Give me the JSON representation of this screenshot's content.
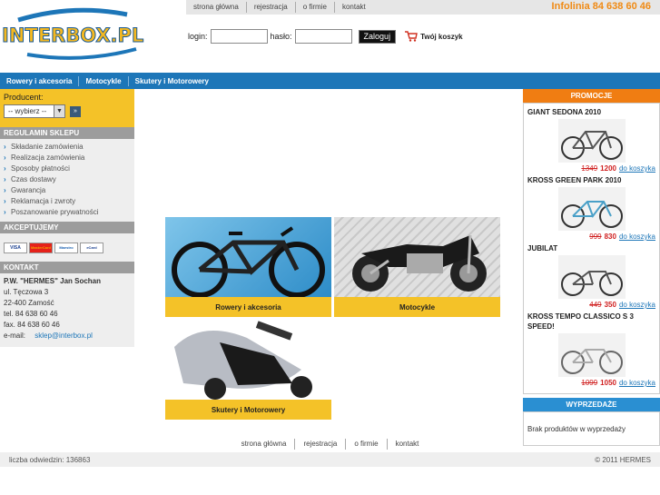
{
  "header": {
    "logo_text": "INTERBOX.PL",
    "top_nav": [
      "strona główna",
      "rejestracja",
      "o firmie",
      "kontakt"
    ],
    "infolinia": "Infolinia 84 638 60 46",
    "login_label": "login:",
    "password_label": "hasło:",
    "login_button": "Zaloguj",
    "cart_label": "Twój koszyk"
  },
  "nav": [
    "Rowery i akcesoria",
    "Motocykle",
    "Skutery i Motorowery"
  ],
  "left": {
    "producer_label": "Producent:",
    "producer_select": "-- wybierz --",
    "regulamin_title": "REGULAMIN SKLEPU",
    "regulamin_items": [
      "Składanie zamówienia",
      "Realizacja zamówienia",
      "Sposoby płatności",
      "Czas dostawy",
      "Gwarancja",
      "Reklamacja i zwroty",
      "Poszanowanie prywatności"
    ],
    "accept_title": "AKCEPTUJEMY",
    "cards": [
      "VISA",
      "MasterCard",
      "Maestro",
      "eCard"
    ],
    "contact_title": "KONTAKT",
    "contact": {
      "company": "P.W. \"HERMES\" Jan Sochan",
      "street": "ul. Tęczowa 3",
      "city": "22-400 Zamość",
      "tel": "tel. 84 638 60 46",
      "fax": "fax. 84 638 60 46",
      "email_label": "e-mail:",
      "email": "sklep@interbox.pl"
    }
  },
  "categories": [
    {
      "label": "Rowery i akcesoria"
    },
    {
      "label": "Motocykle"
    },
    {
      "label": "Skutery i Motorowery"
    }
  ],
  "right": {
    "promo_title": "PROMOCJE",
    "promos": [
      {
        "name": "GIANT SEDONA 2010",
        "old": "1349",
        "new": "1200",
        "link": "do koszyka"
      },
      {
        "name": "KROSS GREEN PARK 2010",
        "old": "999",
        "new": "830",
        "link": "do koszyka"
      },
      {
        "name": "JUBILAT",
        "old": "449",
        "new": "350",
        "link": "do koszyka"
      },
      {
        "name": "KROSS TEMPO CLASSICO S 3 SPEED!",
        "old": "1099",
        "new": "1050",
        "link": "do koszyka"
      }
    ],
    "sale_title": "WYPRZEDAŻE",
    "sale_text": "Brak produktów w wyprzedaży"
  },
  "footer": {
    "nav": [
      "strona główna",
      "rejestracja",
      "o firmie",
      "kontakt"
    ],
    "visits": "liczba odwiedzin: 136863",
    "copyright": "© 2011 HERMES"
  },
  "colors": {
    "accent": "#f4c228",
    "nav_blue": "#1d76b8",
    "promo_orange": "#f07d12",
    "sale_blue": "#2a8fd2"
  }
}
